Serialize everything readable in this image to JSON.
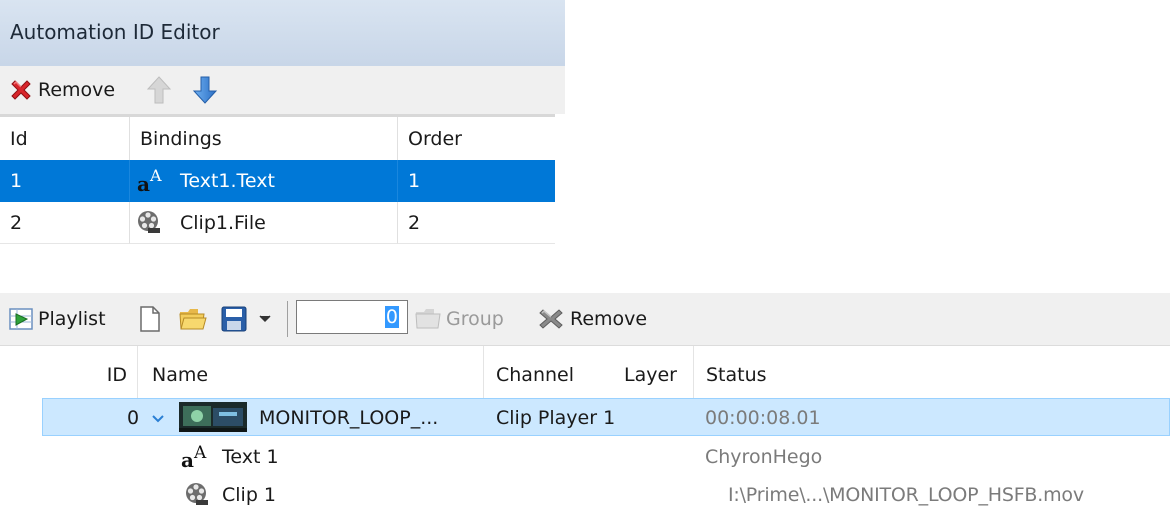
{
  "automation_editor": {
    "title": "Automation ID Editor",
    "toolbar": {
      "remove_label": "Remove",
      "remove_icon": "red-x-icon",
      "move_up_icon": "arrow-up-icon",
      "move_down_icon": "arrow-down-icon"
    },
    "columns": [
      "Id",
      "Bindings",
      "Order"
    ],
    "rows": [
      {
        "id": "1",
        "binding": "Text1.Text",
        "icon": "text-icon",
        "order": "1",
        "selected": true
      },
      {
        "id": "2",
        "binding": "Clip1.File",
        "icon": "film-reel-icon",
        "order": "2",
        "selected": false
      }
    ]
  },
  "playlist": {
    "toolbar": {
      "playlist_label": "Playlist",
      "number_value": "0",
      "group_label": "Group",
      "remove_label": "Remove"
    },
    "columns": [
      "ID",
      "Name",
      "Channel",
      "Layer",
      "Status"
    ],
    "rows": [
      {
        "id": "0",
        "name": "MONITOR_LOOP_...",
        "channel": "Clip Player 1",
        "layer": "",
        "status": "00:00:08.01",
        "selected": true
      },
      {
        "id": "",
        "name": "Text 1",
        "channel": "",
        "layer": "",
        "status": "ChyronHego",
        "selected": false
      },
      {
        "id": "",
        "name": "Clip 1",
        "channel": "",
        "layer": "",
        "status": "I:\\Prime\\...\\MONITOR_LOOP_HSFB.mov",
        "selected": false
      }
    ]
  },
  "colors": {
    "selection": "#0078d7",
    "selection_light": "#cce8ff",
    "title_bar": "#c8d6e8"
  }
}
